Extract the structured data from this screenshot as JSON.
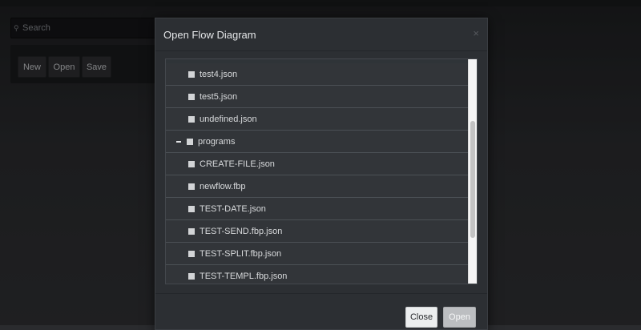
{
  "search": {
    "placeholder": "Search"
  },
  "toolbar": {
    "new_label": "New",
    "open_label": "Open",
    "save_label": "Save"
  },
  "dialog": {
    "title": "Open Flow Diagram",
    "close_glyph": "×",
    "items": [
      {
        "label": "test4.json",
        "kind": "file"
      },
      {
        "label": "test5.json",
        "kind": "file"
      },
      {
        "label": "undefined.json",
        "kind": "file"
      },
      {
        "label": "programs",
        "kind": "folder",
        "expanded": true
      },
      {
        "label": "CREATE-FILE.json",
        "kind": "file"
      },
      {
        "label": "newflow.fbp",
        "kind": "file"
      },
      {
        "label": "TEST-DATE.json",
        "kind": "file"
      },
      {
        "label": "TEST-SEND.fbp.json",
        "kind": "file"
      },
      {
        "label": "TEST-SPLIT.fbp.json",
        "kind": "file"
      },
      {
        "label": "TEST-TEMPL.fbp.json",
        "kind": "file"
      }
    ],
    "footer": {
      "close_label": "Close",
      "open_label": "Open"
    }
  },
  "colors": {
    "background": "#2a2b2e",
    "modal": "#2c2f33",
    "list_row": "#323539",
    "primary_disabled": "#bcbec1"
  },
  "icons": [
    "search-icon",
    "close-icon",
    "file-icon",
    "folder-icon",
    "collapse-icon"
  ]
}
